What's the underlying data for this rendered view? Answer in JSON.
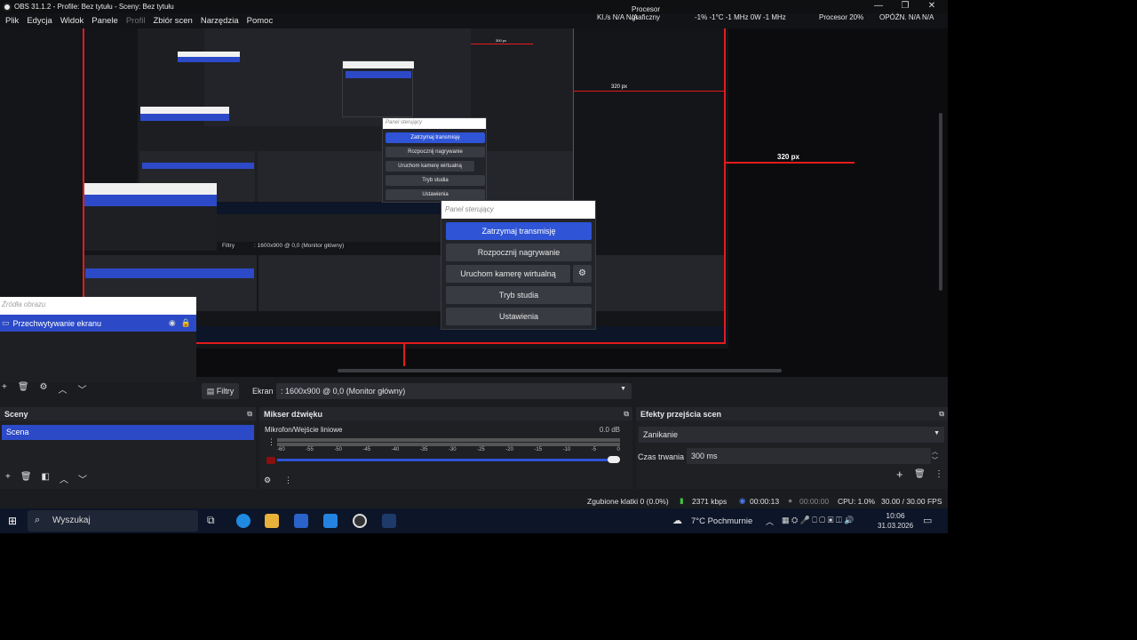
{
  "titlebar": {
    "title": "OBS 31.1.2 - Profile: Bez tytułu - Sceny: Bez tytułu",
    "min": "—",
    "max": "❐",
    "close": "✕"
  },
  "menubar": {
    "items": [
      "Plik",
      "Edycja",
      "Widok",
      "Panele",
      "Profil",
      "Zbiór scen",
      "Narzędzia",
      "Pomoc"
    ]
  },
  "perf": {
    "kbs": "Kl./s  N/A  N/A",
    "gpu_label": "Procesor\ngraficzny",
    "gpu_stats": "-1%  -1°C  -1 MHz  0W  -1 MHz",
    "cpu": "Procesor 20%",
    "latency": "OPÓŹN.  N/A  N/A"
  },
  "preview": {
    "label_320_small": "320 px",
    "label_320_mid": "320 px",
    "label_320_big": "320 px",
    "label_300": "300 px"
  },
  "control_panel": {
    "header": "Panel sterujący",
    "buttons": [
      "Zatrzymaj transmisję",
      "Rozpocznij nagrywanie",
      "Uruchom kamerę wirtualną",
      "Tryb studia",
      "Ustawienia"
    ],
    "gear": "⚙"
  },
  "sources": {
    "header": "Źródła obrazu",
    "item": "Przechwytywanie ekranu"
  },
  "source_toolbar": {
    "filters": "Filtry",
    "screen_label": "Ekran",
    "screen_value": ": 1600x900 @ 0,0 (Monitor główny)"
  },
  "scenes": {
    "title": "Sceny",
    "items": [
      "Scena"
    ]
  },
  "mixer": {
    "title": "Mikser dźwięku",
    "channel": "Mikrofon/Wejście liniowe",
    "db": "0.0 dB",
    "ticks": [
      "-60",
      "-55",
      "-50",
      "-45",
      "-40",
      "-35",
      "-30",
      "-25",
      "-20",
      "-15",
      "-10",
      "-5",
      "0"
    ]
  },
  "transitions": {
    "title": "Efekty przejścia scen",
    "selected": "Zanikanie",
    "duration_label": "Czas trwania",
    "duration_value": "300 ms"
  },
  "status": {
    "dropped": "Zgubione klatki 0 (0.0%)",
    "kbps": "2371 kbps",
    "stream_time": "00:00:13",
    "rec_time": "00:00:00",
    "cpu": "CPU: 1.0%",
    "fps": "30.00 / 30.00 FPS"
  },
  "taskbar": {
    "search": "Wyszukaj",
    "weather": "7°C  Pochmurnie",
    "time": "10:06",
    "date": "31.03.2026"
  },
  "colors": {
    "accent_blue": "#2c4ac7",
    "red_border": "#e31b1b",
    "taskbar": "#0d1528"
  }
}
